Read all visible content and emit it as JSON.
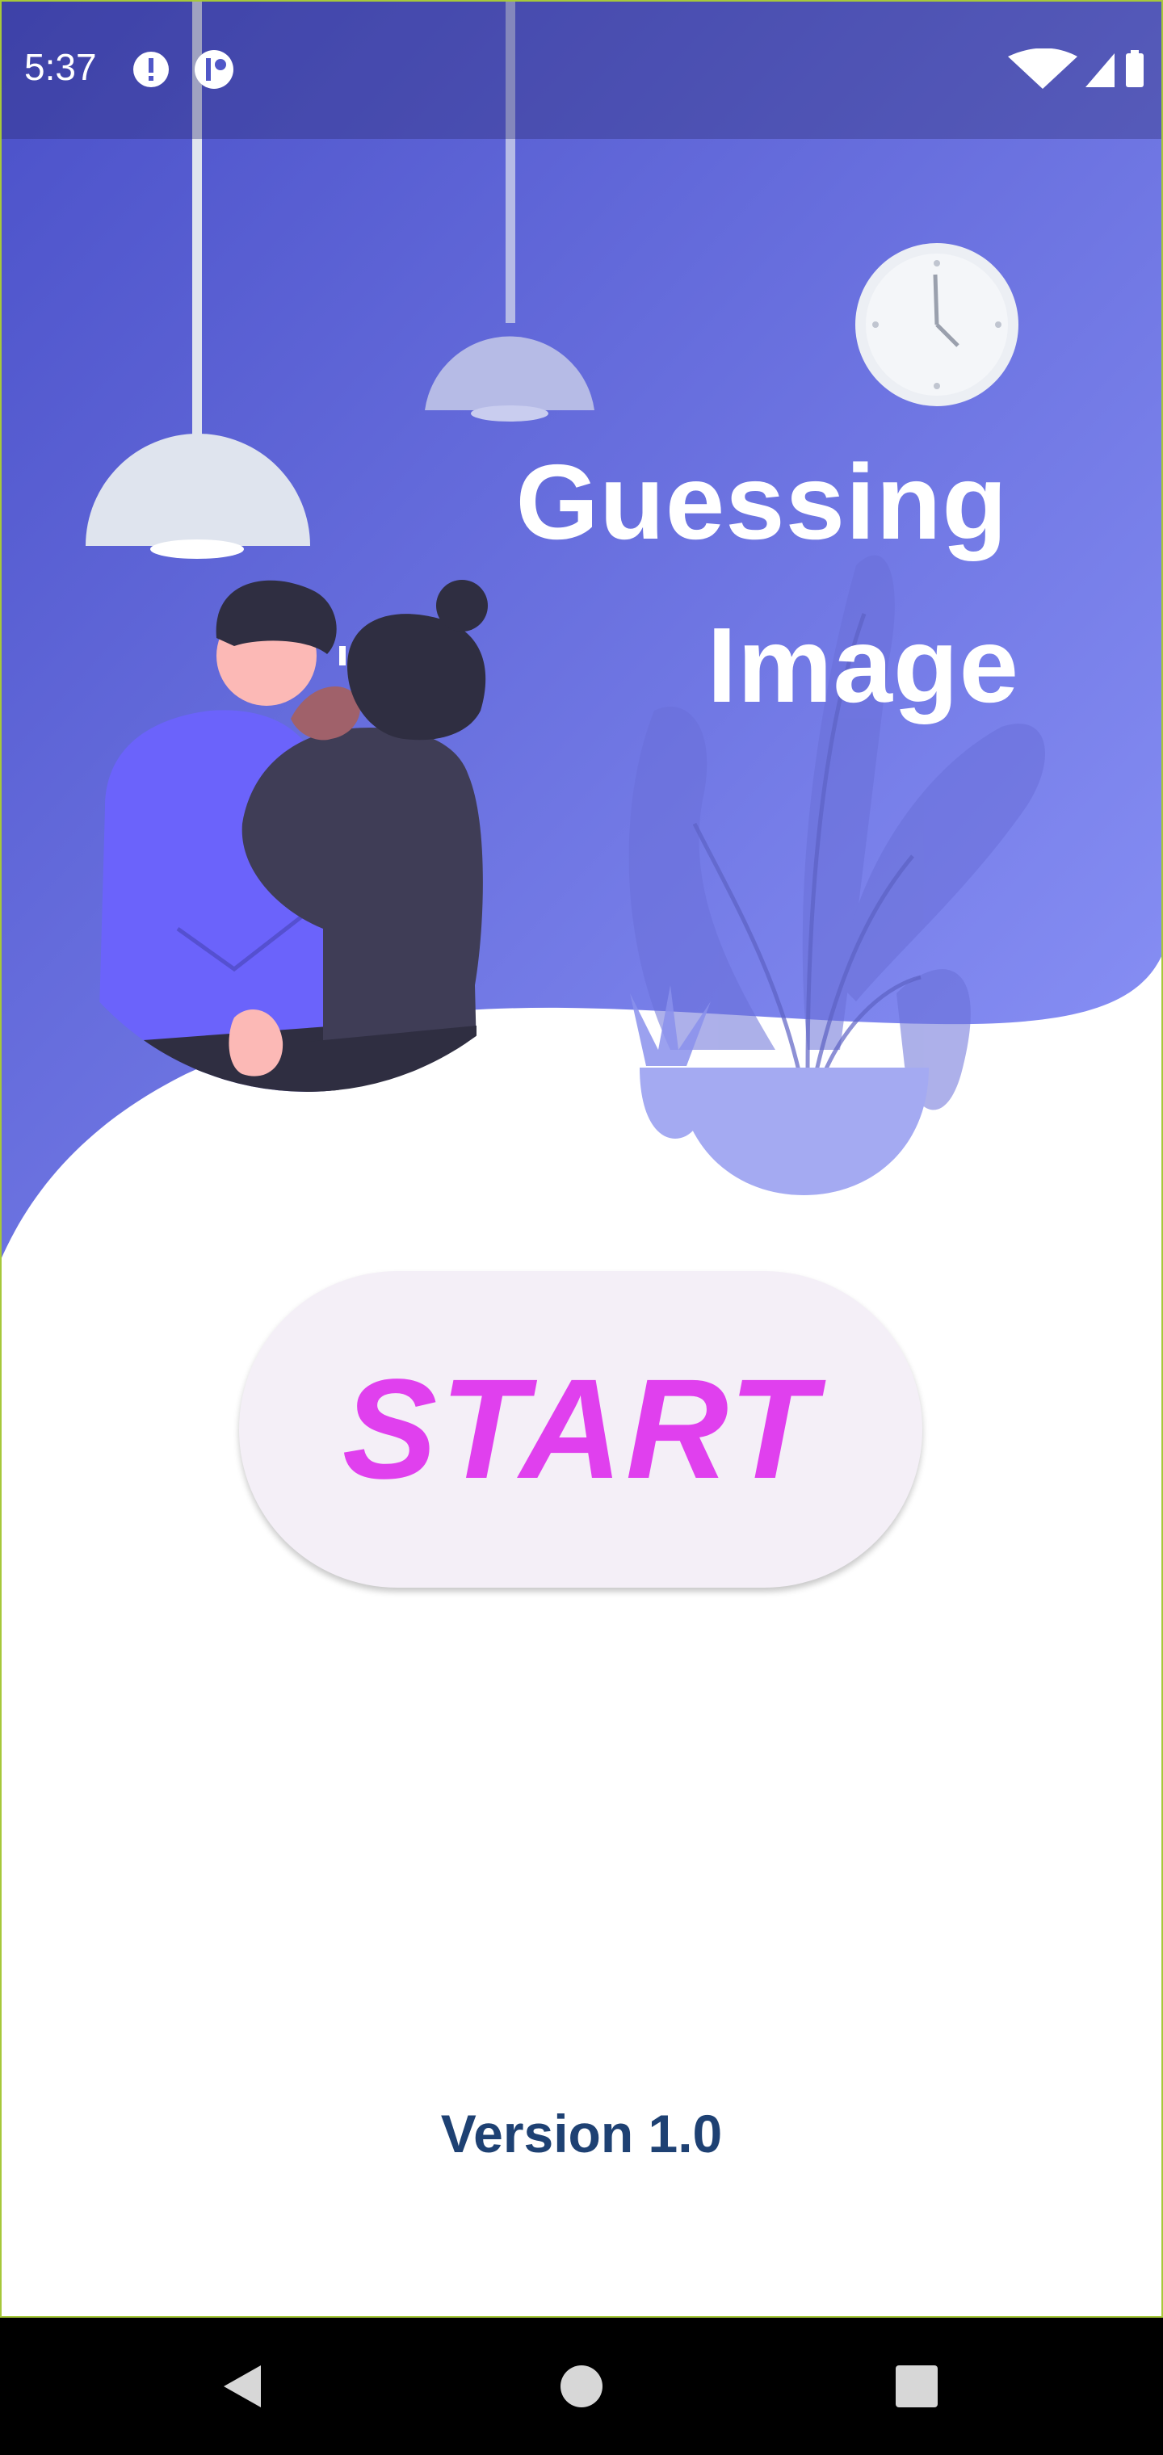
{
  "status_bar": {
    "time": "5:37",
    "left_icons": [
      "alert-icon",
      "notification-app-icon"
    ],
    "right_icons": [
      "wifi-icon",
      "signal-icon",
      "battery-icon"
    ]
  },
  "hero": {
    "title_line_1": "Guessing",
    "title_line_2": "Image",
    "illustration": [
      "pendant-lamp",
      "wall-clock",
      "couple",
      "plant-pot"
    ]
  },
  "start_button": {
    "label": "START"
  },
  "footer": {
    "version": "Version 1.0"
  },
  "nav_bar": {
    "buttons": [
      "back-icon",
      "home-icon",
      "recents-icon"
    ]
  },
  "colors": {
    "hero_gradient_start": "#4a50c8",
    "hero_gradient_end": "#8c94f8",
    "start_label": "#e040ee",
    "start_background": "#f4eff7",
    "version_text": "#1e4173",
    "frame_border": "#a6c83a"
  }
}
